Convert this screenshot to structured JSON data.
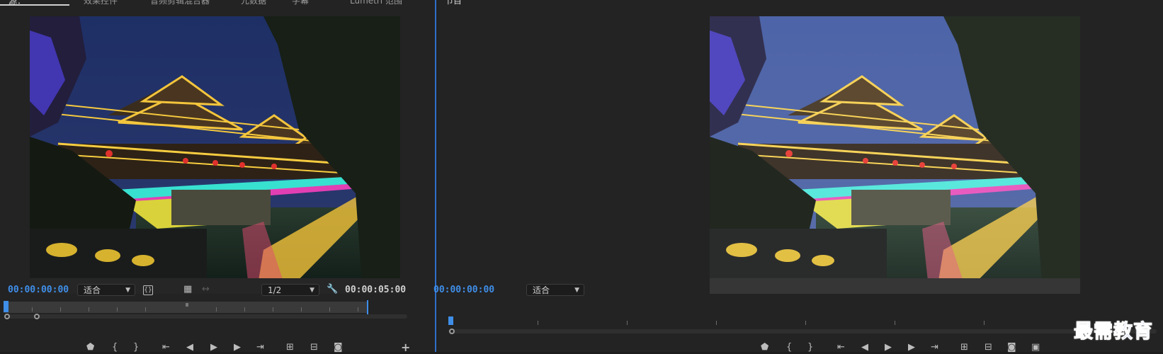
{
  "source_monitor": {
    "tabs": [
      "源：",
      "效果控件",
      "音频剪辑混合器",
      "元数据",
      "字幕",
      "Lumetri 范围"
    ],
    "timecode_in": "00:00:00:00",
    "zoom": "适合",
    "resolution": "1/2",
    "duration": "00:00:05:00"
  },
  "program_monitor": {
    "tabs": [
      "节目"
    ],
    "timecode": "00:00:00:00",
    "zoom": "适合"
  },
  "icons": {
    "marker": "marker-icon",
    "mark_in": "mark-in-icon",
    "mark_out": "mark-out-icon",
    "go_to_in": "go-to-in-icon",
    "step_back": "step-back-icon",
    "play": "play-icon",
    "step_forward": "step-forward-icon",
    "go_to_out": "go-to-out-icon",
    "insert": "insert-icon",
    "overwrite": "overwrite-icon",
    "export_frame": "camera-icon",
    "settings": "wrench-icon",
    "add": "plus-icon"
  },
  "watermark": "最需教育",
  "colors": {
    "accent": "#3f8ee8",
    "panel_bg": "#232323",
    "watermark": "#1c3fd1"
  }
}
